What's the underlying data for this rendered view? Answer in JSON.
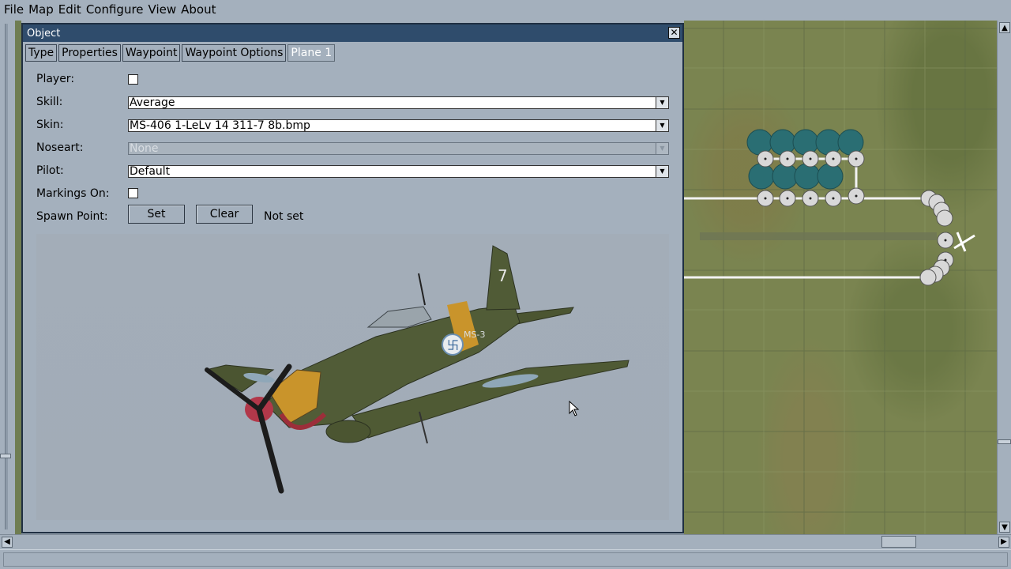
{
  "menubar": {
    "items": [
      "File",
      "Map",
      "Edit",
      "Configure",
      "View",
      "About"
    ]
  },
  "dialog": {
    "title": "Object",
    "close_glyph": "✕",
    "tabs": [
      "Type",
      "Properties",
      "Waypoint",
      "Waypoint Options",
      "Plane 1"
    ],
    "active_tab": "Plane 1",
    "fields": {
      "player_label": "Player:",
      "player_checked": false,
      "skill_label": "Skill:",
      "skill_value": "Average",
      "skin_label": "Skin:",
      "skin_value": "MS-406 1-LeLv 14 311-7 8b.bmp",
      "noseart_label": "Noseart:",
      "noseart_value": "None",
      "pilot_label": "Pilot:",
      "pilot_value": "Default",
      "markings_label": "Markings On:",
      "markings_checked": false,
      "spawn_label": "Spawn Point:",
      "set_button": "Set",
      "clear_button": "Clear",
      "spawn_status": "Not set"
    },
    "preview": {
      "aircraft": "MS-406",
      "tail_code": "MS-3"
    }
  },
  "icons": {
    "dropdown": "dropdown-arrow-icon",
    "close": "close-icon",
    "scroll_up": "scroll-up-icon",
    "scroll_down": "scroll-down-icon",
    "scroll_left": "scroll-left-icon",
    "scroll_right": "scroll-right-icon"
  },
  "colors": {
    "ui_background": "#a4b0bd",
    "titlebar": "#2f4c6c",
    "map_grass": "#7a8450",
    "marker_teal": "#2a6e73"
  }
}
